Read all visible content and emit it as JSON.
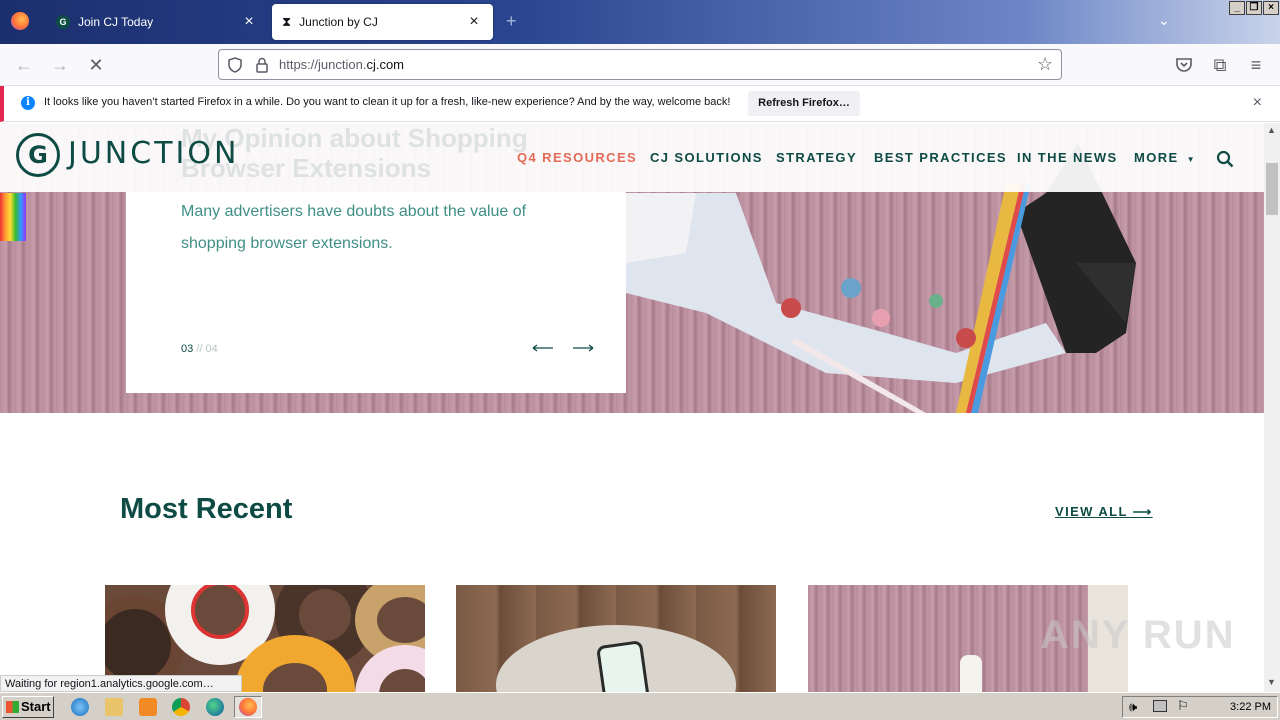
{
  "browser": {
    "tabs": [
      {
        "title": "Join CJ Today",
        "icon": "cj-logo-icon"
      },
      {
        "title": "Junction by CJ",
        "icon": "hourglass-loading-icon"
      }
    ],
    "new_tab_label": "+",
    "url": {
      "prefix": "https://junction.",
      "domain": "cj.com"
    },
    "notification": {
      "message": "It looks like you haven’t started Firefox in a while. Do you want to clean it up for a fresh, like-new experience? And by the way, welcome back!",
      "button": "Refresh Firefox…"
    },
    "status_text": "Waiting for region1.analytics.google.com…"
  },
  "site": {
    "logo_text": "JUNCTION",
    "nav": [
      {
        "label": "Q4 RESOURCES",
        "active": true
      },
      {
        "label": "CJ SOLUTIONS"
      },
      {
        "label": "STRATEGY"
      },
      {
        "label": "BEST PRACTICES"
      },
      {
        "label": "IN THE NEWS"
      },
      {
        "label": "MORE"
      }
    ],
    "hero": {
      "ghost_title_line1": "My Opinion about Shopping",
      "ghost_title_line2": "Browser Extensions",
      "description": "Many advertisers have doubts about the value of shopping browser extensions.",
      "pager_current": "03",
      "pager_sep": "//",
      "pager_total": "04"
    },
    "most_recent": {
      "title": "Most Recent",
      "view_all": "VIEW ALL ⟶"
    }
  },
  "watermark": "ANY RUN",
  "taskbar": {
    "start_label": "Start",
    "clock": "3:22 PM"
  },
  "colors": {
    "brand": "#0e4b45",
    "accent": "#e36b55",
    "teal_text": "#3f8f86"
  }
}
